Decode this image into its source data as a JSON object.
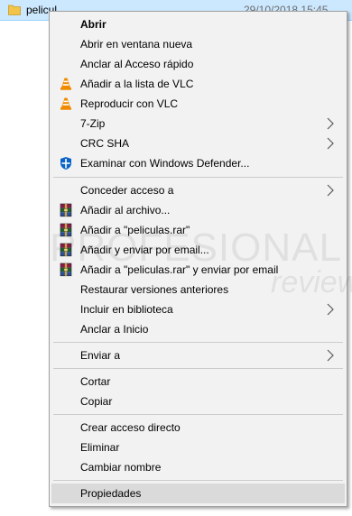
{
  "file": {
    "name": "pelicul",
    "date": "29/10/2018 15:45"
  },
  "watermark": {
    "line1": "PROFESIONAL",
    "line2": "review"
  },
  "menu": {
    "abrir": "Abrir",
    "abrir_ventana": "Abrir en ventana nueva",
    "anclar_acceso": "Anclar al Acceso rápido",
    "vlc_lista": "Añadir a la lista de VLC",
    "vlc_reproducir": "Reproducir con VLC",
    "zip": "7-Zip",
    "crc": "CRC SHA",
    "defender": "Examinar con Windows Defender...",
    "conceder": "Conceder acceso a",
    "rar_archivo": "Añadir al archivo...",
    "rar_peliculas": "Añadir a \"peliculas.rar\"",
    "rar_email": "Añadir y enviar por email...",
    "rar_peliculas_email": "Añadir a \"peliculas.rar\" y enviar por email",
    "restaurar": "Restaurar versiones anteriores",
    "biblioteca": "Incluir en biblioteca",
    "anclar_inicio": "Anclar a Inicio",
    "enviar": "Enviar a",
    "cortar": "Cortar",
    "copiar": "Copiar",
    "acceso_directo": "Crear acceso directo",
    "eliminar": "Eliminar",
    "cambiar_nombre": "Cambiar nombre",
    "propiedades": "Propiedades"
  },
  "colors": {
    "menu_bg": "#f2f2f2",
    "hover_bg": "#dadada",
    "selection": "#cce8ff",
    "vlc_orange": "#f08b00",
    "defender_blue": "#0a64c8"
  }
}
